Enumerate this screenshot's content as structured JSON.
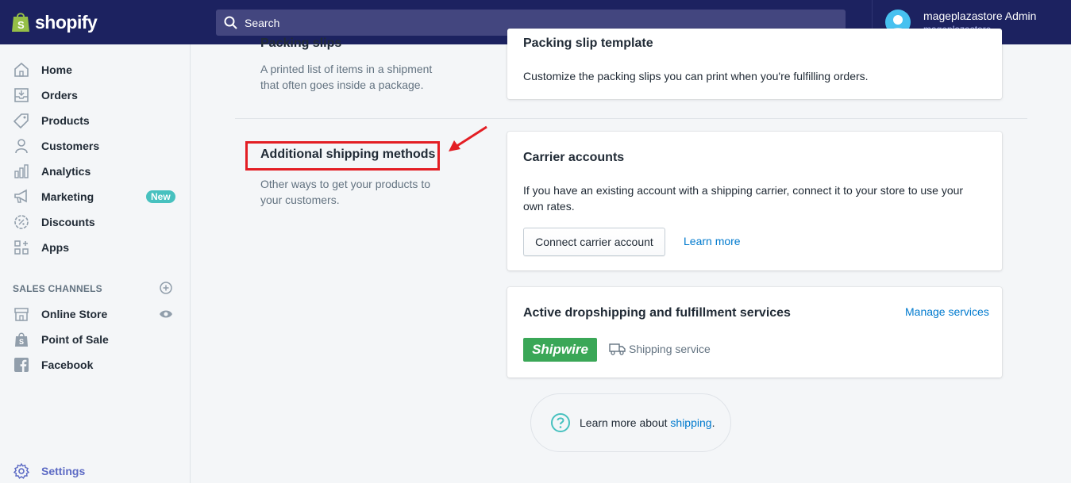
{
  "brand": {
    "name": "shopify"
  },
  "search": {
    "placeholder": "Search"
  },
  "user": {
    "name": "mageplazastore Admin",
    "store": "mageplazastore"
  },
  "sidebar": {
    "items": [
      {
        "label": "Home",
        "icon": "home-icon"
      },
      {
        "label": "Orders",
        "icon": "orders-icon"
      },
      {
        "label": "Products",
        "icon": "tag-icon"
      },
      {
        "label": "Customers",
        "icon": "person-icon"
      },
      {
        "label": "Analytics",
        "icon": "bar-chart-icon"
      },
      {
        "label": "Marketing",
        "icon": "megaphone-icon",
        "badge": "New"
      },
      {
        "label": "Discounts",
        "icon": "discount-icon"
      },
      {
        "label": "Apps",
        "icon": "apps-icon"
      }
    ],
    "channels_title": "SALES CHANNELS",
    "channels": [
      {
        "label": "Online Store",
        "icon": "store-icon"
      },
      {
        "label": "Point of Sale",
        "icon": "pos-bag-icon"
      },
      {
        "label": "Facebook",
        "icon": "facebook-icon"
      }
    ],
    "settings": "Settings"
  },
  "main": {
    "packing": {
      "section_title_partial": "Packing slips",
      "description": [
        "A printed list of items in a shipment",
        "that often goes inside a package."
      ],
      "card_title_partial": "Packing slip template",
      "card_text": "Customize the packing slips you can print when you're fulfilling orders."
    },
    "additional": {
      "title": "Additional shipping methods",
      "description": [
        "Other ways to get your products to",
        "your customers."
      ]
    },
    "carrier": {
      "title": "Carrier accounts",
      "text": [
        "If you have an existing account with a shipping carrier, connect it to your store to use your",
        "own rates."
      ],
      "button": "Connect carrier account",
      "link": "Learn more"
    },
    "dropship": {
      "title": "Active dropshipping and fulfillment services",
      "manage": "Manage services",
      "logo_text": "Shipwire",
      "service": "Shipping service"
    },
    "help": {
      "prefix": "Learn more about ",
      "link": "shipping",
      "suffix": "."
    }
  },
  "colors": {
    "topbar": "#1c2260",
    "highlight": "#e31e24",
    "link": "#007ace",
    "badge": "#47c1bf",
    "shipwire": "#3aa757"
  }
}
